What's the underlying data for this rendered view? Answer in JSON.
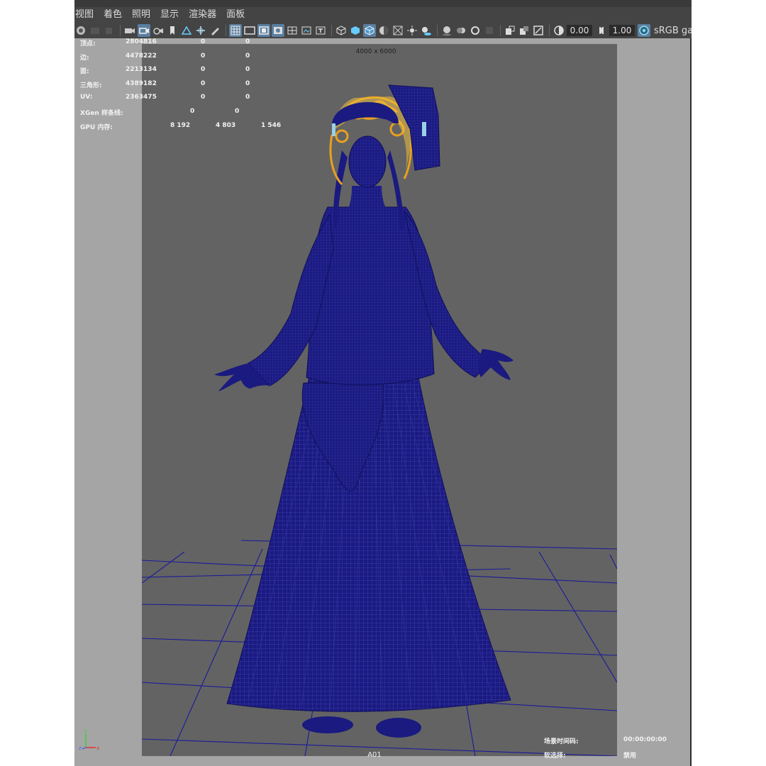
{
  "menu": [
    "视图",
    "着色",
    "照明",
    "显示",
    "渲染器",
    "面板"
  ],
  "toolbar": {
    "exposure": "0.00",
    "gamma": "1.00",
    "color_space": "sRGB ga"
  },
  "viewport": {
    "resolution_gate": "4000 x 6000",
    "camera": "A01"
  },
  "hud": {
    "rows": [
      {
        "label": "顶点:",
        "values": [
          "2804816",
          "0",
          "0"
        ]
      },
      {
        "label": "边:",
        "values": [
          "4478222",
          "0",
          "0"
        ]
      },
      {
        "label": "面:",
        "values": [
          "2213134",
          "0",
          "0"
        ]
      },
      {
        "label": "三角形:",
        "values": [
          "4389182",
          "0",
          "0"
        ]
      },
      {
        "label": "UV:",
        "values": [
          "2363475",
          "0",
          "0"
        ]
      },
      {
        "label": "XGen 样条线:",
        "values": [
          "",
          "0",
          "0"
        ]
      },
      {
        "label": "GPU 内存:",
        "values": [
          "8 192",
          "4 803",
          "1 546"
        ]
      }
    ],
    "bottom_right": {
      "time_label": "场景时间码:",
      "time_value": "00:00:00:00",
      "selection_label": "软选择:",
      "selection_value": "禁用"
    }
  },
  "colors": {
    "wireframe": "#1a1a80",
    "ornament": "#e8a020",
    "viewport_bg": "#636363",
    "outside_gate": "#a5a5a5",
    "grid": "#1a1a9a"
  },
  "icons": [
    "select-camera-icon",
    "camera-icon",
    "bookmark-icon",
    "wireframe-icon",
    "smooth-shade-icon",
    "textured-icon",
    "lights-icon",
    "isolate-icon",
    "grid-icon",
    "film-gate-icon",
    "resolution-gate-icon",
    "exposure-icon",
    "gamma-icon",
    "color-management-icon"
  ]
}
